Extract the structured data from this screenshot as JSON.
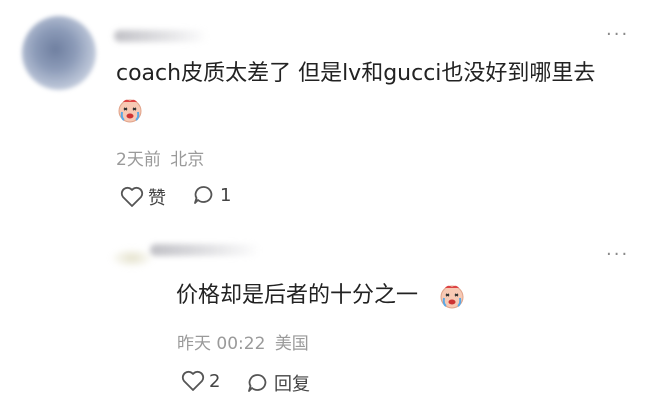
{
  "comment": {
    "more_label": "···",
    "text": "coach皮质太差了 但是lv和gucci也没好到哪里去",
    "time": "2天前",
    "location": "北京",
    "like_label": "赞",
    "reply_count": "1"
  },
  "reply": {
    "more_label": "···",
    "text": "价格却是后者的十分之一",
    "time": "昨天 00:22",
    "location": "美国",
    "like_count": "2",
    "reply_label": "回复"
  },
  "colors": {
    "text": "#222222",
    "meta": "#9a9a9a",
    "icon": "#444444"
  }
}
